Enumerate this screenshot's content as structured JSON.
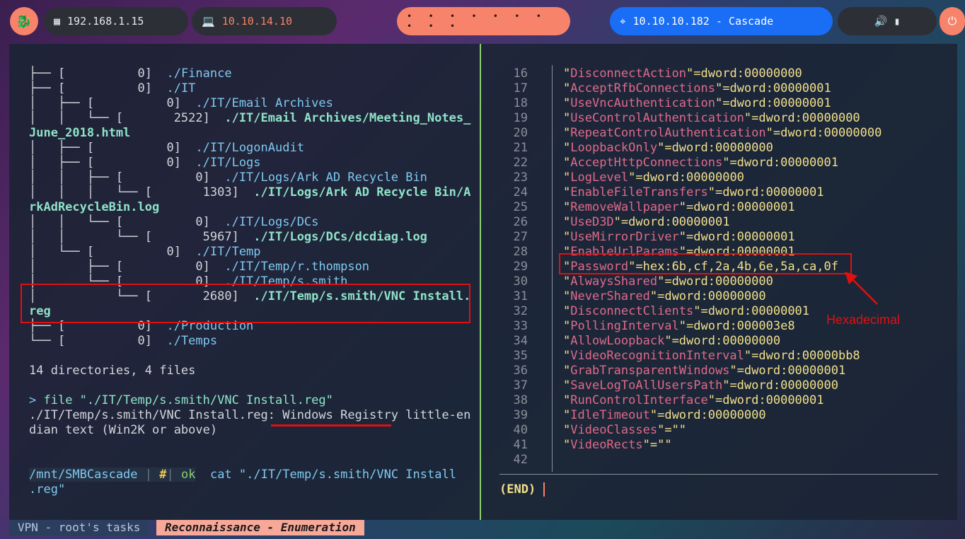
{
  "topbar": {
    "kali_icon": "kali-dragon-icon",
    "host_ip": "192.168.1.15",
    "vpn_ip": "10.10.14.10",
    "workspaces": "• • • • • • • • • •",
    "target": "10.10.10.182 - Cascade",
    "tray": "🔊  ▮",
    "power_icon": "⏻"
  },
  "left": {
    "tree_lines": [
      {
        "tree": "├── [          0]  ",
        "path": "./Finance",
        "bold": false
      },
      {
        "tree": "├── [          0]  ",
        "path": "./IT",
        "bold": false
      },
      {
        "tree": "│   ├── [          0]  ",
        "path": "./IT/Email Archives",
        "bold": false
      },
      {
        "tree": "│   │   └── [       2522]  ",
        "path": "./IT/Email Archives/Meeting_Notes_",
        "bold": true
      },
      {
        "tree": "",
        "path": "June_2018.html",
        "bold": true
      },
      {
        "tree": "│   ├── [          0]  ",
        "path": "./IT/LogonAudit",
        "bold": false
      },
      {
        "tree": "│   ├── [          0]  ",
        "path": "./IT/Logs",
        "bold": false
      },
      {
        "tree": "│   │   ├── [          0]  ",
        "path": "./IT/Logs/Ark AD Recycle Bin",
        "bold": false
      },
      {
        "tree": "│   │   │   └── [       1303]  ",
        "path": "./IT/Logs/Ark AD Recycle Bin/A",
        "bold": true
      },
      {
        "tree": "",
        "path": "rkAdRecycleBin.log",
        "bold": true
      },
      {
        "tree": "│   │   └── [          0]  ",
        "path": "./IT/Logs/DCs",
        "bold": false
      },
      {
        "tree": "│   │       └── [       5967]  ",
        "path": "./IT/Logs/DCs/dcdiag.log",
        "bold": true
      },
      {
        "tree": "│   └── [          0]  ",
        "path": "./IT/Temp",
        "bold": false
      },
      {
        "tree": "│       ├── [          0]  ",
        "path": "./IT/Temp/r.thompson",
        "bold": false
      },
      {
        "tree": "│       └── [          0]  ",
        "path": "./IT/Temp/s.smith",
        "bold": false
      },
      {
        "tree": "│           └── [       2680]  ",
        "path": "./IT/Temp/s.smith/VNC Install.",
        "bold": true
      },
      {
        "tree": "",
        "path": "reg",
        "bold": true
      },
      {
        "tree": "├── [          0]  ",
        "path": "./Production",
        "bold": false
      },
      {
        "tree": "└── [          0]  ",
        "path": "./Temps",
        "bold": false
      }
    ],
    "summary": "14 directories, 4 files",
    "cmd_prompt": "> ",
    "cmd": "file \"./IT/Temp/s.smith/VNC Install.reg\"",
    "result_line1": "./IT/Temp/s.smith/VNC Install.reg: Windows Registry little-en",
    "result_line2": "dian text (Win2K or above)",
    "prompt_path": "/mnt/SMBCascade",
    "prompt_sep1": " | ",
    "prompt_hash": "#",
    "prompt_sep2": "| ",
    "prompt_ok": "ok",
    "prompt_cmd": "cat \"./IT/Temp/s.smith/VNC Install",
    "prompt_cmd_cont": ".reg\""
  },
  "right": {
    "lines": [
      {
        "n": "16",
        "key": "DisconnectAction",
        "val": "=dword:00000000"
      },
      {
        "n": "17",
        "key": "AcceptRfbConnections",
        "val": "=dword:00000001"
      },
      {
        "n": "18",
        "key": "UseVncAuthentication",
        "val": "=dword:00000001"
      },
      {
        "n": "19",
        "key": "UseControlAuthentication",
        "val": "=dword:00000000"
      },
      {
        "n": "20",
        "key": "RepeatControlAuthentication",
        "val": "=dword:00000000"
      },
      {
        "n": "21",
        "key": "LoopbackOnly",
        "val": "=dword:00000000"
      },
      {
        "n": "22",
        "key": "AcceptHttpConnections",
        "val": "=dword:00000001"
      },
      {
        "n": "23",
        "key": "LogLevel",
        "val": "=dword:00000000"
      },
      {
        "n": "24",
        "key": "EnableFileTransfers",
        "val": "=dword:00000001"
      },
      {
        "n": "25",
        "key": "RemoveWallpaper",
        "val": "=dword:00000001"
      },
      {
        "n": "26",
        "key": "UseD3D",
        "val": "=dword:00000001"
      },
      {
        "n": "27",
        "key": "UseMirrorDriver",
        "val": "=dword:00000001"
      },
      {
        "n": "28",
        "key": "EnableUrlParams",
        "val": "=dword:00000001"
      },
      {
        "n": "29",
        "key": "Password",
        "val": "=hex:6b,cf,2a,4b,6e,5a,ca,0f"
      },
      {
        "n": "30",
        "key": "AlwaysShared",
        "val": "=dword:00000000"
      },
      {
        "n": "31",
        "key": "NeverShared",
        "val": "=dword:00000000"
      },
      {
        "n": "32",
        "key": "DisconnectClients",
        "val": "=dword:00000001"
      },
      {
        "n": "33",
        "key": "PollingInterval",
        "val": "=dword:000003e8"
      },
      {
        "n": "34",
        "key": "AllowLoopback",
        "val": "=dword:00000000"
      },
      {
        "n": "35",
        "key": "VideoRecognitionInterval",
        "val": "=dword:00000bb8"
      },
      {
        "n": "36",
        "key": "GrabTransparentWindows",
        "val": "=dword:00000001"
      },
      {
        "n": "37",
        "key": "SaveLogToAllUsersPath",
        "val": "=dword:00000000"
      },
      {
        "n": "38",
        "key": "RunControlInterface",
        "val": "=dword:00000001"
      },
      {
        "n": "39",
        "key": "IdleTimeout",
        "val": "=dword:00000000"
      },
      {
        "n": "40",
        "key": "VideoClasses",
        "val": "=\"\""
      },
      {
        "n": "41",
        "key": "VideoRects",
        "val": "=\"\""
      },
      {
        "n": "42",
        "key": "",
        "val": ""
      }
    ],
    "end_marker": "(END)",
    "annotation": "Hexadecimal"
  },
  "status": {
    "tasks": "VPN - root's tasks",
    "phase": "Reconnaissance - Enumeration"
  },
  "colors": {
    "accent": "#f7836a",
    "target_blue": "#1a6ef5",
    "highlight_red": "#e01010"
  }
}
